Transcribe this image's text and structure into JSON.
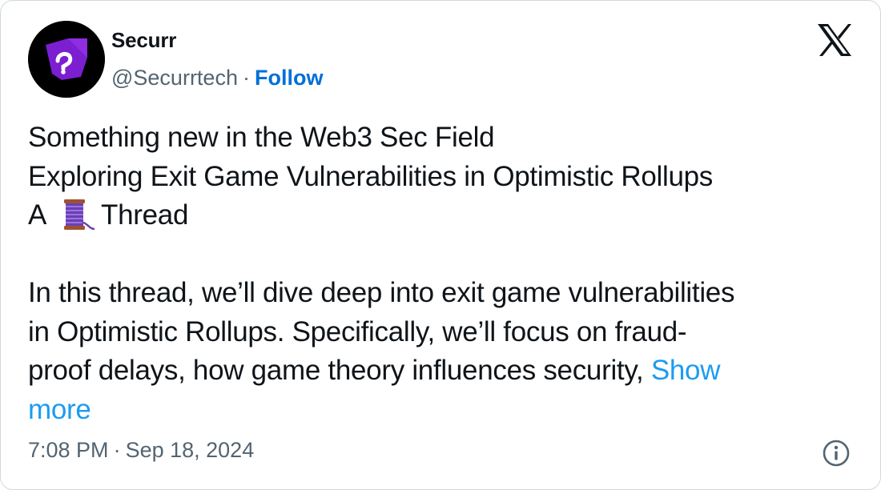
{
  "account": {
    "name": "Securr",
    "handle": "@Securrtech",
    "separator": "·",
    "follow_label": "Follow",
    "avatar_icon": "securr-logo-icon"
  },
  "platform": {
    "logo_icon": "x-logo-icon"
  },
  "post": {
    "line1": "Something new in the Web3 Sec Field",
    "line2": "Exploring Exit Game Vulnerabilities in Optimistic Rollups",
    "line3_prefix": "A",
    "line3_emoji_icon": "thread-spool-icon",
    "line3_suffix": "Thread",
    "para_line1": "In this thread, we’ll dive deep into exit game vulnerabilities",
    "para_line2": "in Optimistic Rollups. Specifically, we’ll focus on fraud-",
    "para_line3": "proof delays, how game theory influences security,",
    "show_more_part1": "Show",
    "show_more_part2": "more"
  },
  "footer": {
    "time": "7:08 PM",
    "separator": "·",
    "date": "Sep 18, 2024",
    "info_icon": "info-icon"
  },
  "colors": {
    "text": "#0f1419",
    "secondary": "#536471",
    "follow": "#006fd6",
    "link": "#1d9bf0",
    "border": "#cfd9de",
    "avatar_purple": "#7b1fd1"
  }
}
